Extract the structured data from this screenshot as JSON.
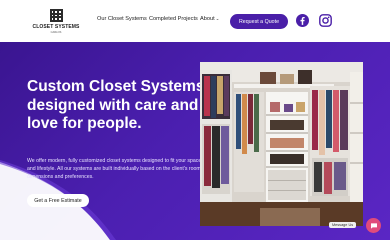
{
  "brand": {
    "name": "CLOSET SYSTEMS",
    "tagline": "CARLOS"
  },
  "nav": {
    "items": [
      {
        "label": "Our Closet Systems"
      },
      {
        "label": "Completed Projects"
      },
      {
        "label": "About"
      }
    ],
    "quote_button": "Request a Quote"
  },
  "social": {
    "icons": [
      "facebook-icon",
      "instagram-icon"
    ]
  },
  "hero": {
    "title": "Custom Closet Systems designed with care and love for people.",
    "description": "We offer modern, fully customized closet systems designed to fit your space and lifestyle. All our systems are built individually based on the client's room dimensions and preferences.",
    "cta_button": "Get a Free Estimate"
  },
  "chat": {
    "tooltip": "Message Us"
  },
  "colors": {
    "brand_purple": "#4a1fa8",
    "hero_bg": "#4b1fb0",
    "chat_pink": "#e04b7b"
  }
}
